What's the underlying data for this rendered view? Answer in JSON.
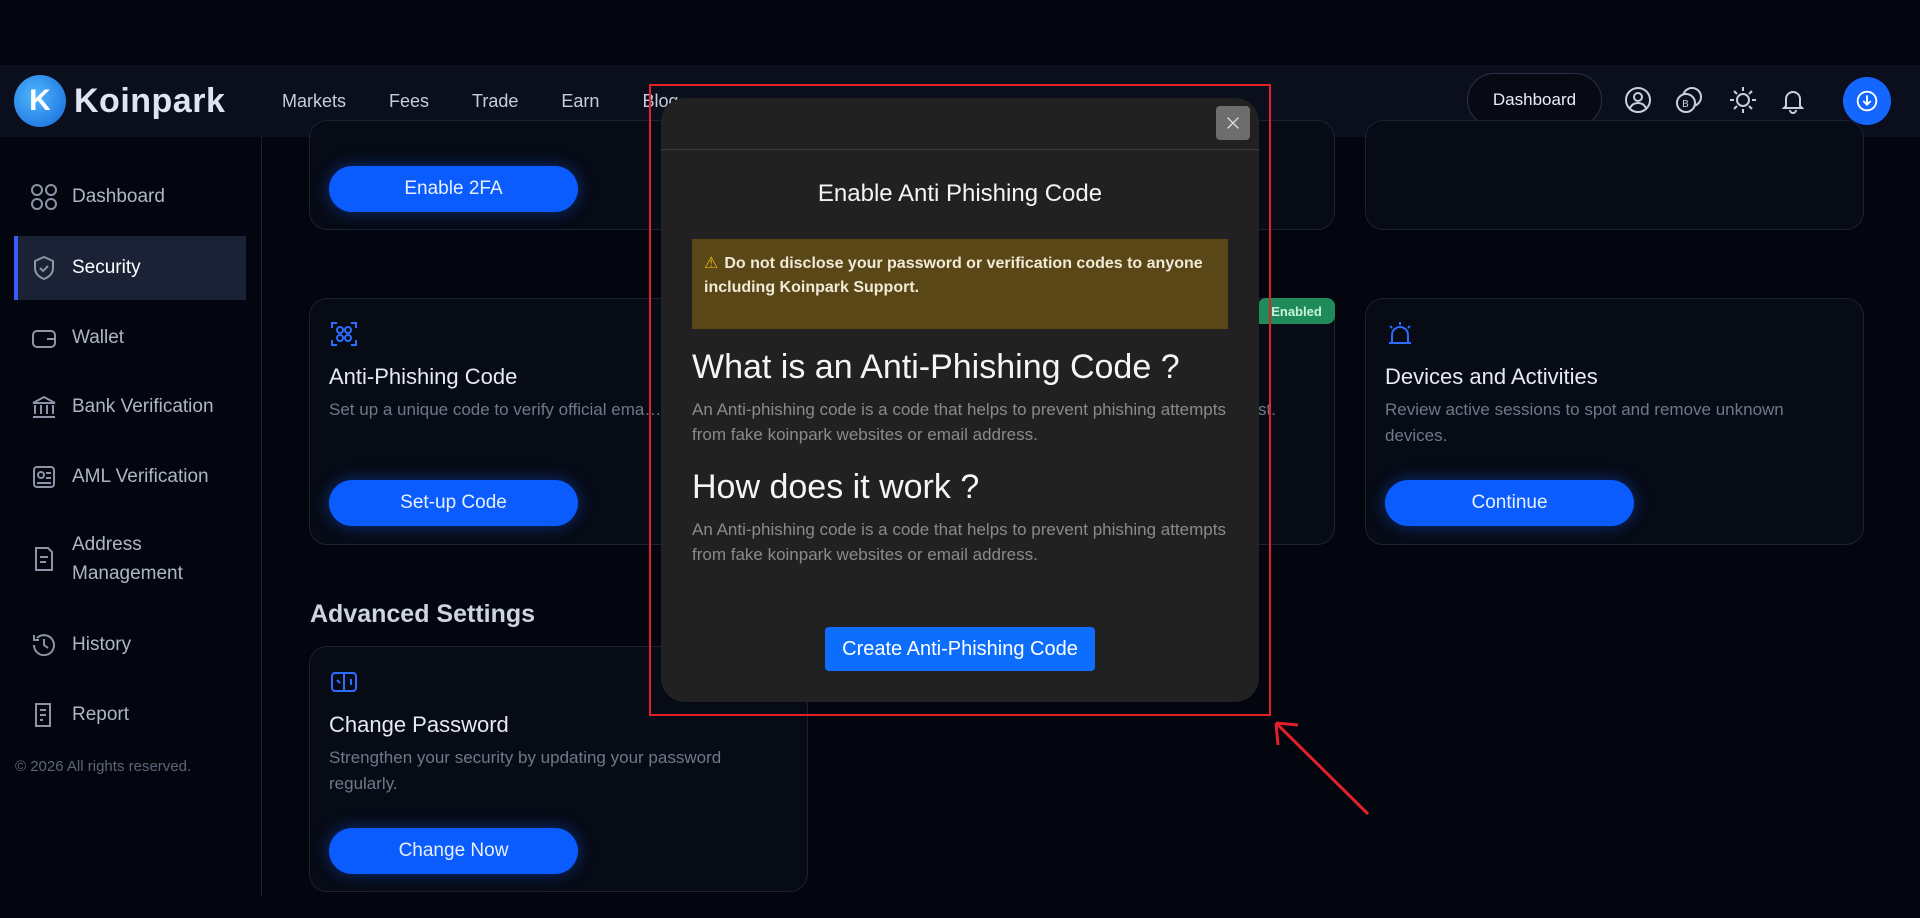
{
  "brand": {
    "name": "Koinpark",
    "logo_letter": "K"
  },
  "nav": {
    "items": [
      "Markets",
      "Fees",
      "Trade",
      "Earn",
      "Blog"
    ]
  },
  "header": {
    "dashboard_label": "Dashboard",
    "icons": [
      "user-icon",
      "wallet-coin-icon",
      "theme-toggle-icon",
      "bell-icon",
      "download-icon"
    ]
  },
  "sidebar": {
    "items": [
      {
        "label": "Dashboard",
        "icon": "grid-icon",
        "active": false
      },
      {
        "label": "Security",
        "icon": "shield-icon",
        "active": true
      },
      {
        "label": "Wallet",
        "icon": "wallet-icon",
        "active": false
      },
      {
        "label": "Bank Verification",
        "icon": "bank-icon",
        "active": false
      },
      {
        "label": "AML Verification",
        "icon": "id-card-icon",
        "active": false
      },
      {
        "label": "Address Management",
        "icon": "document-icon",
        "active": false
      },
      {
        "label": "History",
        "icon": "history-icon",
        "active": false
      },
      {
        "label": "Report",
        "icon": "report-icon",
        "active": false
      }
    ],
    "copyright": "© 2026 All rights reserved."
  },
  "cards": {
    "twofa": {
      "button": "Enable 2FA"
    },
    "anti_phishing": {
      "title": "Anti-Phishing Code",
      "desc": "Set up a unique code to verify official ema… scams.",
      "button": "Set-up Code"
    },
    "whitelist": {
      "badge": "Enabled",
      "desc_tail": "elist."
    },
    "devices": {
      "title": "Devices and Activities",
      "desc": "Review active sessions to spot and remove unknown devices.",
      "button": "Continue"
    },
    "advanced_title": "Advanced Settings",
    "password": {
      "title": "Change Password",
      "desc": "Strengthen your security by updating your password regularly.",
      "button": "Change Now"
    }
  },
  "modal": {
    "title": "Enable Anti Phishing Code",
    "warning": "Do not disclose your password or verification codes to anyone including Koinpark Support.",
    "h_what": "What is an Anti-Phishing Code ?",
    "p_what": "An Anti-phishing code is a code that helps to prevent phishing attempts from fake koinpark websites or email address.",
    "h_how": "How does it work ?",
    "p_how": "An Anti-phishing code is a code that helps to prevent phishing attempts from fake koinpark websites or email address.",
    "button": "Create Anti-Phishing Code"
  },
  "colors": {
    "accent": "#0a5cff",
    "modal_bg": "#212121",
    "warning_bg": "#5a4717",
    "highlight": "#e2202a",
    "badge": "#1f8a5a"
  }
}
